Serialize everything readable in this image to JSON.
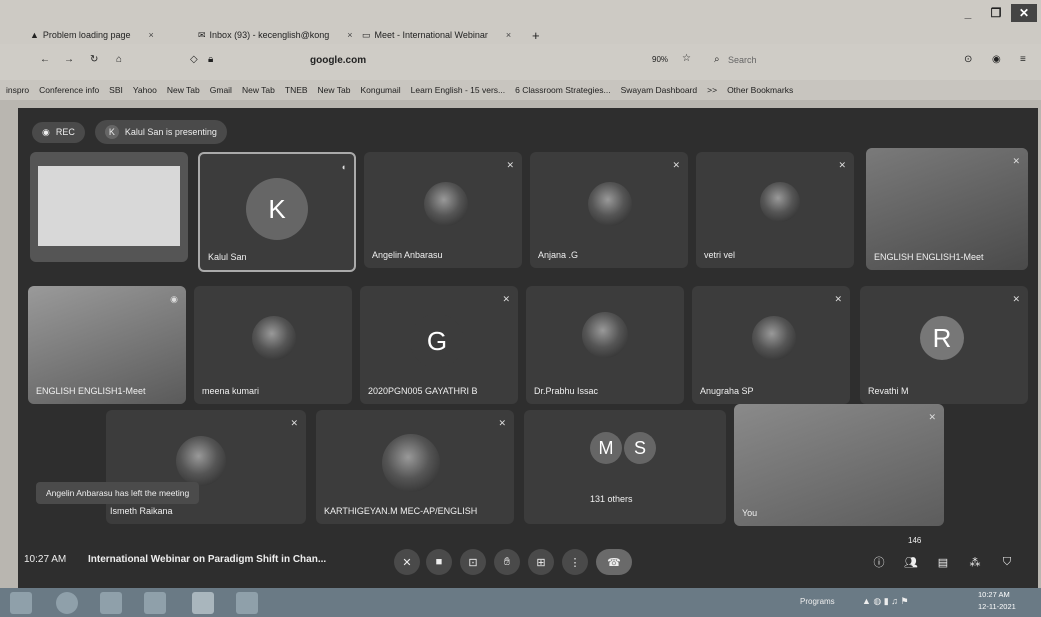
{
  "browser": {
    "tabs": [
      {
        "label": "Problem loading page"
      },
      {
        "label": "Inbox (93) - kecenglish@kong"
      },
      {
        "label": "Meet - International Webinar"
      }
    ],
    "new_tab": "+",
    "url": "google.com",
    "search_placeholder": "Search",
    "zoom": "90%"
  },
  "bookmarks": [
    "inspro",
    "Conference info",
    "SBI",
    "Yahoo",
    "New Tab",
    "Gmail",
    "New Tab",
    "TNEB",
    "New Tab",
    "Kongumail",
    "Learn English - 15 vers...",
    "6 Classroom Strategies...",
    "Swayam Dashboard",
    ">>",
    "Other Bookmarks"
  ],
  "meet": {
    "rec_label": "REC",
    "presenter_initial": "K",
    "presenter_text": "Kalul San is presenting",
    "tiles": [
      {
        "name": ""
      },
      {
        "name": "Kalul San",
        "initial": "K"
      },
      {
        "name": "Angelin Anbarasu"
      },
      {
        "name": "Anjana .G"
      },
      {
        "name": "vetri vel"
      },
      {
        "name": "ENGLISH ENGLISH1-Meet"
      },
      {
        "name": "ENGLISH ENGLISH1-Meet"
      },
      {
        "name": "meena kumari"
      },
      {
        "name": "2020PGN005 GAYATHRI B",
        "initial": "G"
      },
      {
        "name": "Dr.Prabhu Issac"
      },
      {
        "name": "Anugraha SP"
      },
      {
        "name": "Revathi M",
        "initial": "R"
      },
      {
        "name": "Ismeth Raikana"
      },
      {
        "name": "KARTHIGEYAN.M MEC-AP/ENGLISH"
      },
      {
        "name": "131 others",
        "initial1": "M",
        "initial2": "S"
      },
      {
        "name": "You"
      }
    ],
    "toast": "Angelin Anbarasu has left the meeting",
    "time": "10:27 AM",
    "meeting_title": "International Webinar on Paradigm Shift in Chan...",
    "participants_count": "146"
  },
  "taskbar": {
    "programs": "Programs",
    "clock_time": "10:27 AM",
    "clock_date": "12-11-2021"
  }
}
